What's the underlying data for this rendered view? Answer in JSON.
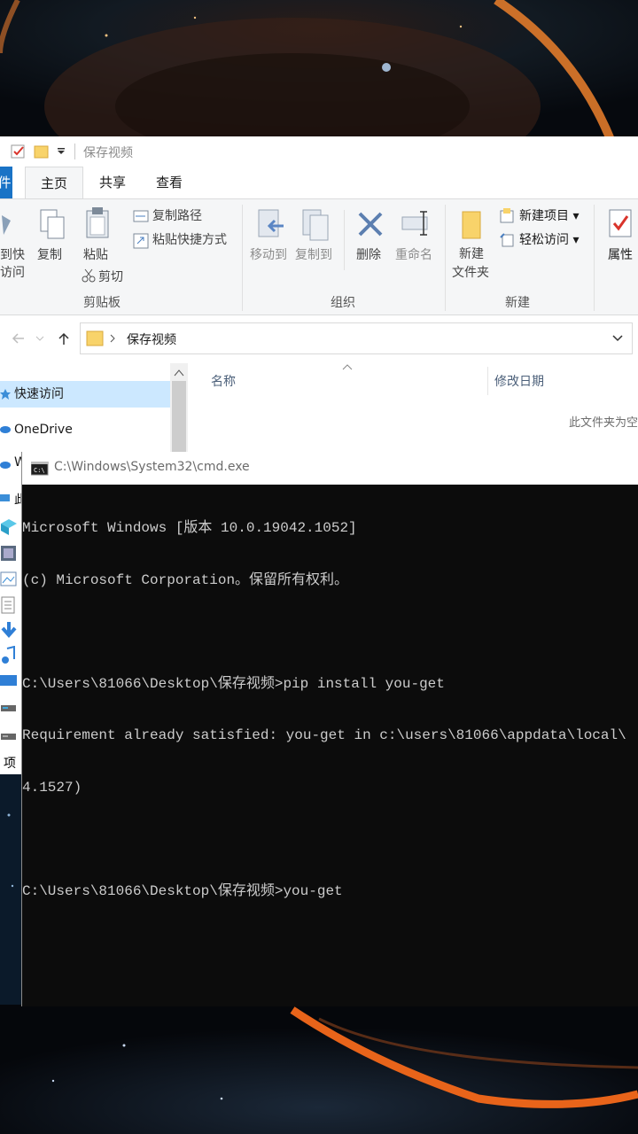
{
  "explorer": {
    "title": "保存视频",
    "tabs": {
      "file": "件",
      "home": "主页",
      "share": "共享",
      "view": "查看"
    },
    "ribbon": {
      "pin_line1": "到快",
      "pin_line2": "访问",
      "copy": "复制",
      "paste": "粘贴",
      "copy_path": "复制路径",
      "paste_shortcut": "粘贴快捷方式",
      "cut": "剪切",
      "clipboard_group": "剪贴板",
      "move_to": "移动到",
      "copy_to": "复制到",
      "delete": "删除",
      "rename": "重命名",
      "organize_group": "组织",
      "new_folder_line1": "新建",
      "new_folder_line2": "文件夹",
      "new_item": "新建项目",
      "easy_access": "轻松访问",
      "new_group": "新建",
      "properties": "属性"
    },
    "address": {
      "path": "保存视频"
    },
    "nav": {
      "quick_access": "快速访问",
      "onedrive": "OneDrive",
      "item3_partial": "W",
      "item4_partial": "此",
      "item_bottom_partial": "项"
    },
    "columns": {
      "name": "名称",
      "date": "修改日期"
    },
    "empty_message": "此文件夹为空"
  },
  "cmd": {
    "title": "C:\\Windows\\System32\\cmd.exe",
    "lines": [
      "Microsoft Windows [版本 10.0.19042.1052]",
      "(c) Microsoft Corporation。保留所有权利。",
      "",
      "C:\\Users\\81066\\Desktop\\保存视频>pip install you-get",
      "Requirement already satisfied: you-get in c:\\users\\81066\\appdata\\local\\",
      "4.1527)",
      "",
      "C:\\Users\\81066\\Desktop\\保存视频>you-get"
    ]
  },
  "colors": {
    "file_tab": "#1a73c6",
    "selected_nav": "#cce8ff",
    "cmd_bg": "#0c0c0c",
    "cmd_text": "#cccccc",
    "wallpaper_ring": "#e8641a"
  }
}
